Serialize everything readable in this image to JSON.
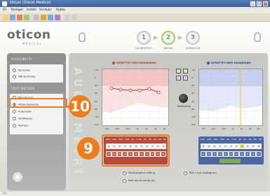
{
  "window": {
    "title": "Oticon (Oticon Medical)",
    "buttons": [
      "_",
      "□",
      "×"
    ]
  },
  "menubar": {
    "items": [
      "Fil",
      "Rediger",
      "Indstil",
      "Vinduer",
      "Hjælp"
    ]
  },
  "logo": {
    "name": "oticon",
    "sub": "MEDICAL"
  },
  "steps": [
    {
      "num": "1",
      "label": "KALIBRERING"
    },
    {
      "num": "2",
      "label": "MÅLING"
    },
    {
      "num": "3",
      "label": "GENNEMGÅ"
    }
  ],
  "sidebar": {
    "head1": "AUDIOMETRI",
    "group1": [
      {
        "label": "Kontroller",
        "on": false
      },
      {
        "label": "Mål kontroller",
        "on": false
      }
    ],
    "head2": "TEST METODE",
    "group2": [
      {
        "label": "Manuel test",
        "on": false
      },
      {
        "label": "Afstandsgrænse",
        "on": true
      },
      {
        "label": "Automatik",
        "on": false
      },
      {
        "label": "Verifikation",
        "on": false
      },
      {
        "label": "Memory",
        "on": false
      }
    ]
  },
  "vertical_label": "AUDIOMETRI",
  "left_panel": {
    "status": "OPRETTET MED MASKERING",
    "x_ticks": [
      "125",
      "250",
      "500",
      "1k",
      "2k",
      "4k",
      "8k"
    ],
    "y_ticks": [
      "-10",
      "0",
      "20",
      "40",
      "60",
      "80",
      "100",
      "120"
    ]
  },
  "right_panel": {
    "status": "OPRETTET MED MASKERING",
    "x_ticks": [
      "125",
      "250",
      "500",
      "1k",
      "2k",
      "4k",
      "8k"
    ],
    "y_ticks": [
      "-10",
      "0",
      "20",
      "40",
      "60",
      "80",
      "100",
      "120"
    ]
  },
  "bone_label": "Benledning",
  "masking_left": {
    "freqs": [
      "125",
      "250",
      "500",
      "750",
      "1k",
      "1.5k",
      "2k",
      "3k",
      "4k",
      "6k",
      "8k"
    ],
    "row1": [
      "M",
      "M",
      "M",
      "M",
      "M",
      "M",
      "M",
      "M",
      "M",
      "M",
      "M"
    ],
    "row2": [
      "A",
      "A",
      "A",
      "A",
      "A",
      "A",
      "A",
      "A",
      "A",
      "A",
      "A"
    ]
  },
  "masking_right": {
    "freqs": [
      "125",
      "250",
      "500",
      "750",
      "1k",
      "1.5k",
      "2k",
      "3k",
      "4k",
      "6k",
      "8k"
    ],
    "row1": [
      "M",
      "M",
      "M",
      "M",
      "M",
      "M",
      "M",
      "M",
      "M",
      "M",
      "M"
    ],
    "row2": [
      "A",
      "A",
      "A",
      "A",
      "A",
      "A",
      "A",
      "A",
      "A",
      "A",
      "A"
    ],
    "highlight_index": 7
  },
  "bottom_options": [
    "Samtidighed måling",
    "Ikke kontinuerlig tid",
    "Bliv i ens audiogram"
  ],
  "callouts": {
    "c9": "9",
    "c10": "10"
  },
  "colors": {
    "orange": "#f07c1e",
    "left_ear": "#c03020",
    "right_ear": "#2040a0"
  },
  "statusbar": "Klar"
}
